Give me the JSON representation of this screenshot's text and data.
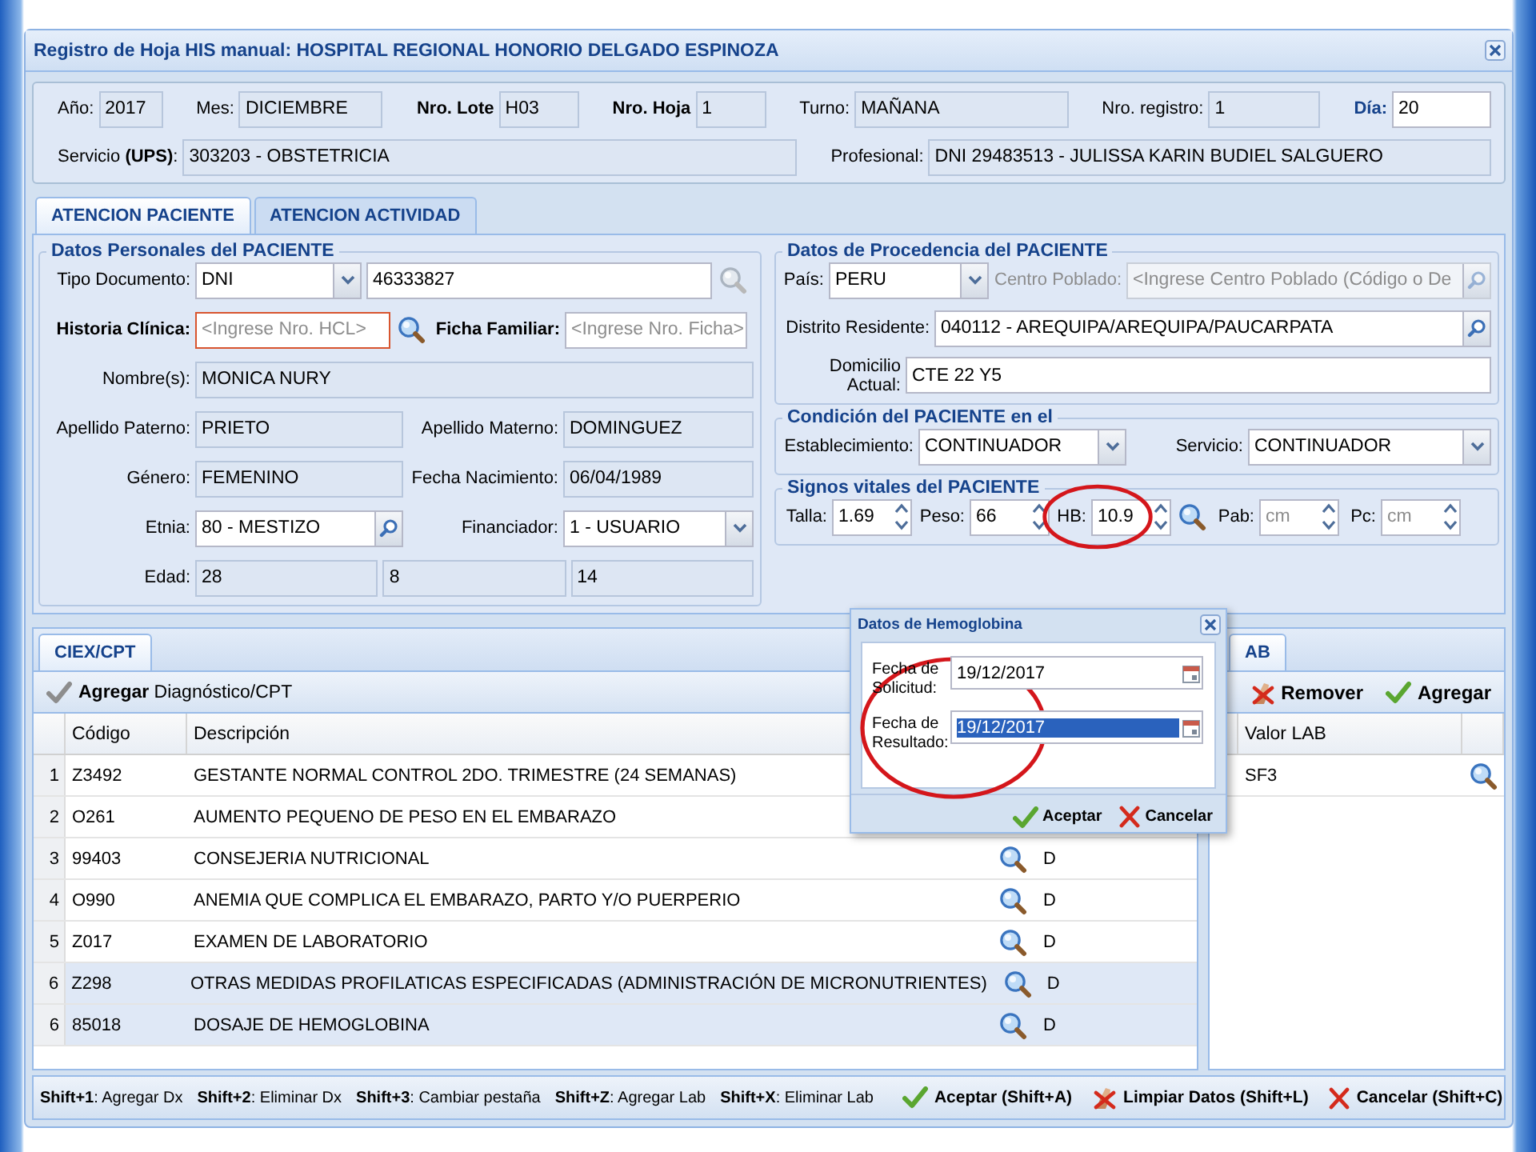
{
  "window": {
    "title": "Registro de Hoja HIS manual: HOSPITAL REGIONAL HONORIO DELGADO ESPINOZA"
  },
  "header": {
    "rows": [
      {
        "items": [
          {
            "label": "Año:",
            "kind": "readonly",
            "value": "2017"
          },
          {
            "label": "Mes:",
            "kind": "readonly",
            "value": "DICIEMBRE"
          },
          {
            "label": "Nro. Lote",
            "kind": "readonly",
            "value": "H03"
          },
          {
            "label": "Nro. Hoja",
            "kind": "readonly",
            "value": "1"
          },
          {
            "label": "Turno:",
            "kind": "readonly",
            "value": "MAÑANA"
          },
          {
            "label": "Nro. registro:",
            "kind": "readonly",
            "value": "1"
          },
          {
            "label": "Día:",
            "kind": "text",
            "value": "20"
          }
        ]
      },
      {
        "items": [
          {
            "label": "Servicio **(UPS)**:",
            "kind": "readonly",
            "value": "303203 - OBSTETRICIA"
          },
          {
            "label": "Profesional:",
            "kind": "readonly",
            "value": "DNI 29483513 - JULISSA KARIN BUDIEL SALGUERO"
          }
        ]
      }
    ]
  },
  "tabs": [
    {
      "label": "ATENCION PACIENTE",
      "selected": true
    },
    {
      "label": "ATENCION ACTIVIDAD",
      "selected": false
    }
  ],
  "personal": {
    "legend": "Datos Personales del PACIENTE",
    "rows": [
      {
        "items": [
          {
            "kind": "label",
            "text": "Tipo Documento:"
          },
          {
            "kind": "combo",
            "value": "DNI"
          },
          {
            "kind": "text",
            "value": "46333827"
          },
          {
            "kind": "search",
            "disabled": true
          }
        ]
      },
      {
        "items": [
          {
            "kind": "label",
            "text": "Historia Clínica:"
          },
          {
            "kind": "text",
            "placeholder": "<Ingrese Nro. HCL>",
            "invalid": true
          },
          {
            "kind": "search",
            "disabled": false
          },
          {
            "kind": "label",
            "text": "Ficha Familiar:"
          },
          {
            "kind": "text",
            "placeholder": "<Ingrese Nro. Ficha>",
            "invalid": false
          }
        ]
      },
      {
        "items": [
          {
            "kind": "label",
            "text": "Nombre(s):"
          },
          {
            "kind": "readonly",
            "value": "MONICA NURY"
          }
        ]
      },
      {
        "items": [
          {
            "kind": "label",
            "text": "Apellido Paterno:"
          },
          {
            "kind": "readonly",
            "value": "PRIETO"
          },
          {
            "kind": "label",
            "text": "Apellido Materno:"
          },
          {
            "kind": "readonly",
            "value": "DOMINGUEZ"
          }
        ]
      },
      {
        "items": [
          {
            "kind": "label",
            "text": "Género:"
          },
          {
            "kind": "readonly",
            "value": "FEMENINO"
          },
          {
            "kind": "label",
            "text": "Fecha Nacimiento:"
          },
          {
            "kind": "readonly",
            "value": "06/04/1989"
          }
        ]
      },
      {
        "items": [
          {
            "kind": "label",
            "text": "Etnia:"
          },
          {
            "kind": "lookup",
            "value": "80 - MESTIZO"
          },
          {
            "kind": "label",
            "text": "Financiador:"
          },
          {
            "kind": "combo",
            "value": "1 - USUARIO"
          }
        ]
      },
      {
        "items": [
          {
            "kind": "label",
            "text": "Edad:"
          },
          {
            "kind": "readonly",
            "value": "28"
          },
          {
            "kind": "readonly",
            "value": "8"
          },
          {
            "kind": "readonly",
            "value": "14"
          }
        ]
      }
    ]
  },
  "origin": {
    "legend": "Datos de Procedencia del PACIENTE",
    "rows": [
      {
        "items": [
          {
            "kind": "label",
            "text": "País:"
          },
          {
            "kind": "combo",
            "value": "PERU",
            "disabled": false
          },
          {
            "kind": "label",
            "text": "Centro Poblado:"
          },
          {
            "kind": "lookup",
            "placeholder": "<Ingrese Centro Poblado (Código o De",
            "disabled": true
          }
        ]
      },
      {
        "items": [
          {
            "kind": "label",
            "text": "Distrito Residente:"
          },
          {
            "kind": "lookup",
            "value": "040112 - AREQUIPA/AREQUIPA/PAUCARPATA"
          }
        ]
      },
      {
        "items": [
          {
            "kind": "label",
            "text": "Domicilio Actual:"
          },
          {
            "kind": "text",
            "value": "CTE 22 Y5"
          }
        ]
      }
    ]
  },
  "condition": {
    "legend": "Condición del PACIENTE en el",
    "rows": [
      {
        "items": [
          {
            "kind": "label",
            "text": "Establecimiento:"
          },
          {
            "kind": "combo",
            "value": "CONTINUADOR"
          },
          {
            "kind": "label",
            "text": "Servicio:"
          },
          {
            "kind": "combo",
            "value": "CONTINUADOR"
          }
        ]
      }
    ]
  },
  "vitals": {
    "legend": "Signos vitales del PACIENTE",
    "rows": [
      {
        "items": [
          {
            "kind": "label",
            "text": "Talla:"
          },
          {
            "kind": "spinner",
            "value": "1.69",
            "circled": false
          },
          {
            "kind": "label",
            "text": "Peso:"
          },
          {
            "kind": "spinner",
            "value": "66",
            "circled": false
          },
          {
            "kind": "label",
            "text": "HB:"
          },
          {
            "kind": "spinner",
            "value": "10.9",
            "circled": true
          },
          {
            "kind": "search",
            "disabled": false
          },
          {
            "kind": "label",
            "text": "Pab:"
          },
          {
            "kind": "spinner",
            "placeholder": "cm",
            "circled": false
          },
          {
            "kind": "label",
            "text": "Pc:"
          },
          {
            "kind": "spinner",
            "placeholder": "cm",
            "circled": false
          }
        ]
      }
    ]
  },
  "diagnoses": {
    "tab": {
      "label": "CIEX/CPT",
      "selected": true
    },
    "toolbar": {
      "label": "**Agregar** Diagnóstico/CPT"
    },
    "columns": [
      "Código",
      "Descripción"
    ],
    "rows": [
      {
        "number": "1",
        "code": "Z3492",
        "description": "GESTANTE NORMAL CONTROL 2DO. TRIMESTRE (24 SEMANAS)",
        "selected": false
      },
      {
        "number": "2",
        "code": "O261",
        "description": "AUMENTO PEQUENO DE PESO EN EL EMBARAZO",
        "selected": false
      },
      {
        "number": "3",
        "code": "99403",
        "description": "CONSEJERIA NUTRICIONAL",
        "type": "D",
        "selected": false
      },
      {
        "number": "4",
        "code": "O990",
        "description": "ANEMIA QUE COMPLICA EL EMBARAZO, PARTO Y/O PUERPERIO",
        "type": "D",
        "selected": false
      },
      {
        "number": "5",
        "code": "Z017",
        "description": "EXAMEN DE LABORATORIO",
        "type": "D",
        "selected": false
      },
      {
        "number": "6",
        "code": "Z298",
        "description": "OTRAS MEDIDAS PROFILATICAS ESPECIFICADAS (ADMINISTRACIÓN DE MICRONUTRIENTES)",
        "type": "D",
        "selected": true
      },
      {
        "number": "6",
        "code": "85018",
        "description": "DOSAJE DE HEMOGLOBINA",
        "type": "D",
        "selected": true
      }
    ]
  },
  "lab": {
    "tab": {
      "label": "AB",
      "selected": true
    },
    "buttons": [
      {
        "label": "Remover",
        "kind": "remove"
      },
      {
        "label": "Agregar",
        "kind": "add"
      }
    ],
    "columns": [
      "Valor LAB"
    ],
    "rows": [
      {
        "value": "SF3"
      }
    ]
  },
  "dialog": {
    "title": "Datos de Hemoglobina",
    "circled": true,
    "fields": [
      {
        "label": "Fecha de Solicitud:",
        "value": "19/12/2017",
        "value_selected": false
      },
      {
        "label": "Fecha de Resultado:",
        "value": "19/12/2017",
        "value_selected": true
      }
    ],
    "buttons": [
      {
        "label": "Aceptar",
        "kind": "accept"
      },
      {
        "label": "Cancelar",
        "kind": "cancel"
      }
    ]
  },
  "footer": {
    "shortcuts": [
      "**Shift+1**: Agregar Dx",
      "**Shift+2**: Eliminar Dx",
      "**Shift+3**: Cambiar pestaña",
      "**Shift+Z**: Agregar Lab",
      "**Shift+X**: Eliminar Lab"
    ],
    "buttons": [
      {
        "label": "Aceptar (Shift+A)",
        "kind": "accept"
      },
      {
        "label": "Limpiar Datos (Shift+L)",
        "kind": "clear"
      },
      {
        "label": "Cancelar (Shift+C)",
        "kind": "cancel"
      }
    ]
  }
}
